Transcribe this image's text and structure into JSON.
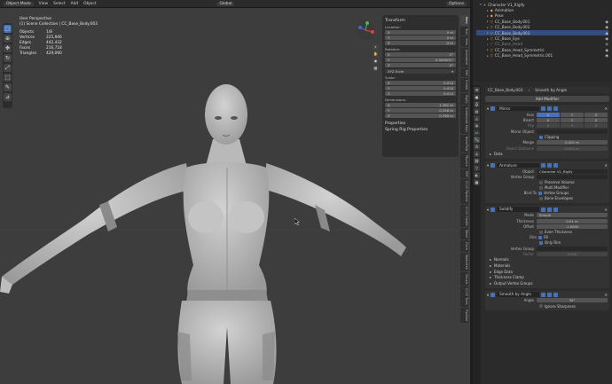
{
  "header": {
    "mode": "Object Mode",
    "menus": [
      "View",
      "Select",
      "Add",
      "Object"
    ],
    "orientation": "Global",
    "options": "Options"
  },
  "overlay": {
    "view_name": "User Perspective",
    "collection": "(1) Scene Collection | CC_Base_Body.003",
    "stats": [
      {
        "k": "Objects",
        "v": "1/8"
      },
      {
        "k": "Vertices",
        "v": "225,946"
      },
      {
        "k": "Edges",
        "v": "442,432"
      },
      {
        "k": "Faces",
        "v": "216,718"
      },
      {
        "k": "Triangles",
        "v": "429,090"
      }
    ]
  },
  "npanel": {
    "transform": "Transform",
    "location": "Location:",
    "loc": [
      {
        "a": "X",
        "v": "0 m"
      },
      {
        "a": "Y",
        "v": "0 m"
      },
      {
        "a": "Z",
        "v": "-0 m"
      }
    ],
    "rotation": "Rotation:",
    "rot": [
      {
        "a": "X",
        "v": "0°"
      },
      {
        "a": "Y",
        "v": "0.000001°"
      },
      {
        "a": "Z",
        "v": "0°"
      }
    ],
    "rot_mode": "XYZ Euler",
    "scale": "Scale:",
    "scl": [
      {
        "a": "X",
        "v": "0.010"
      },
      {
        "a": "Y",
        "v": "0.010"
      },
      {
        "a": "Z",
        "v": "0.010"
      }
    ],
    "dimensions": "Dimensions:",
    "dim": [
      {
        "a": "X",
        "v": "4.362 m"
      },
      {
        "a": "Y",
        "v": "0.256 m"
      },
      {
        "a": "Z",
        "v": "0.769 m"
      }
    ],
    "properties": "Properties",
    "spring": "Spring Rig Properties"
  },
  "tabs": [
    "Item",
    "Tool",
    "View",
    "Animation",
    "Edit",
    "Create",
    "Rigify",
    "Screencast Keys",
    "BoneFlow",
    "Physics",
    "RBF",
    "CC/iC Pipeline",
    "CC/iC Create",
    "Mesh",
    "Cloth",
    "Sketchfab",
    "Decals",
    "CC/iC Tools",
    "Pipeline"
  ],
  "outliner": [
    {
      "name": "Character V1_Rigify",
      "depth": 0
    },
    {
      "name": "Animation",
      "depth": 1
    },
    {
      "name": "Pose",
      "depth": 1
    },
    {
      "name": "CC_Base_Body.001",
      "depth": 1
    },
    {
      "name": "CC_Base_Body.002",
      "depth": 1
    },
    {
      "name": "CC_Base_Body.003",
      "depth": 1
    },
    {
      "name": "CC_Base_Eye",
      "depth": 1
    },
    {
      "name": "CC_Base_Head",
      "depth": 1
    },
    {
      "name": "CC_Base_Head_Symmetric",
      "depth": 1
    },
    {
      "name": "CC_Base_Head_Symmetric.001",
      "depth": 1
    }
  ],
  "properties": {
    "object": "CC_Base_Body.003",
    "modifier": "Smooth by Angle",
    "add_modifier": "Add Modifier",
    "mirror": {
      "name": "Mirror",
      "axis": "Axis",
      "bisect": "Bisect",
      "flip": "Flip",
      "axes": [
        "X",
        "Y",
        "Z"
      ],
      "mirror_object": "Mirror Object",
      "clipping": "Clipping",
      "merge": "Merge",
      "merge_val": "0.001 m",
      "bisect_distance": "Bisect Distance",
      "bisect_val": "0.001 m",
      "data": "Data"
    },
    "armature": {
      "name": "Armature",
      "object": "Object",
      "object_val": "Character V1_Rigify",
      "vgroup": "Vertex Group",
      "preserve": "Preserve Volume",
      "multi": "Multi Modifier",
      "bind": "Bind To",
      "bind_vg": "Vertex Groups",
      "bone_env": "Bone Envelopes"
    },
    "solidify": {
      "name": "Solidify",
      "mode": "Mode",
      "mode_val": "Simple",
      "thickness": "Thickness",
      "thickness_val": "0.01 m",
      "offset": "Offset",
      "offset_val": "-1.0000",
      "even": "Even Thickness",
      "rim": "Rim",
      "fill": "Fill",
      "only_rim": "Only Rim",
      "vgroup": "Vertex Group",
      "factor": "Factor",
      "factor_val": "0.000",
      "normals": "Normals",
      "materials": "Materials",
      "edge": "Edge Data",
      "clamp": "Thickness Clamp",
      "output": "Output Vertex Groups"
    },
    "smooth": {
      "name": "Smooth by Angle",
      "angle": "Angle",
      "angle_val": "30°",
      "ignore": "Ignore Sharpness"
    }
  }
}
